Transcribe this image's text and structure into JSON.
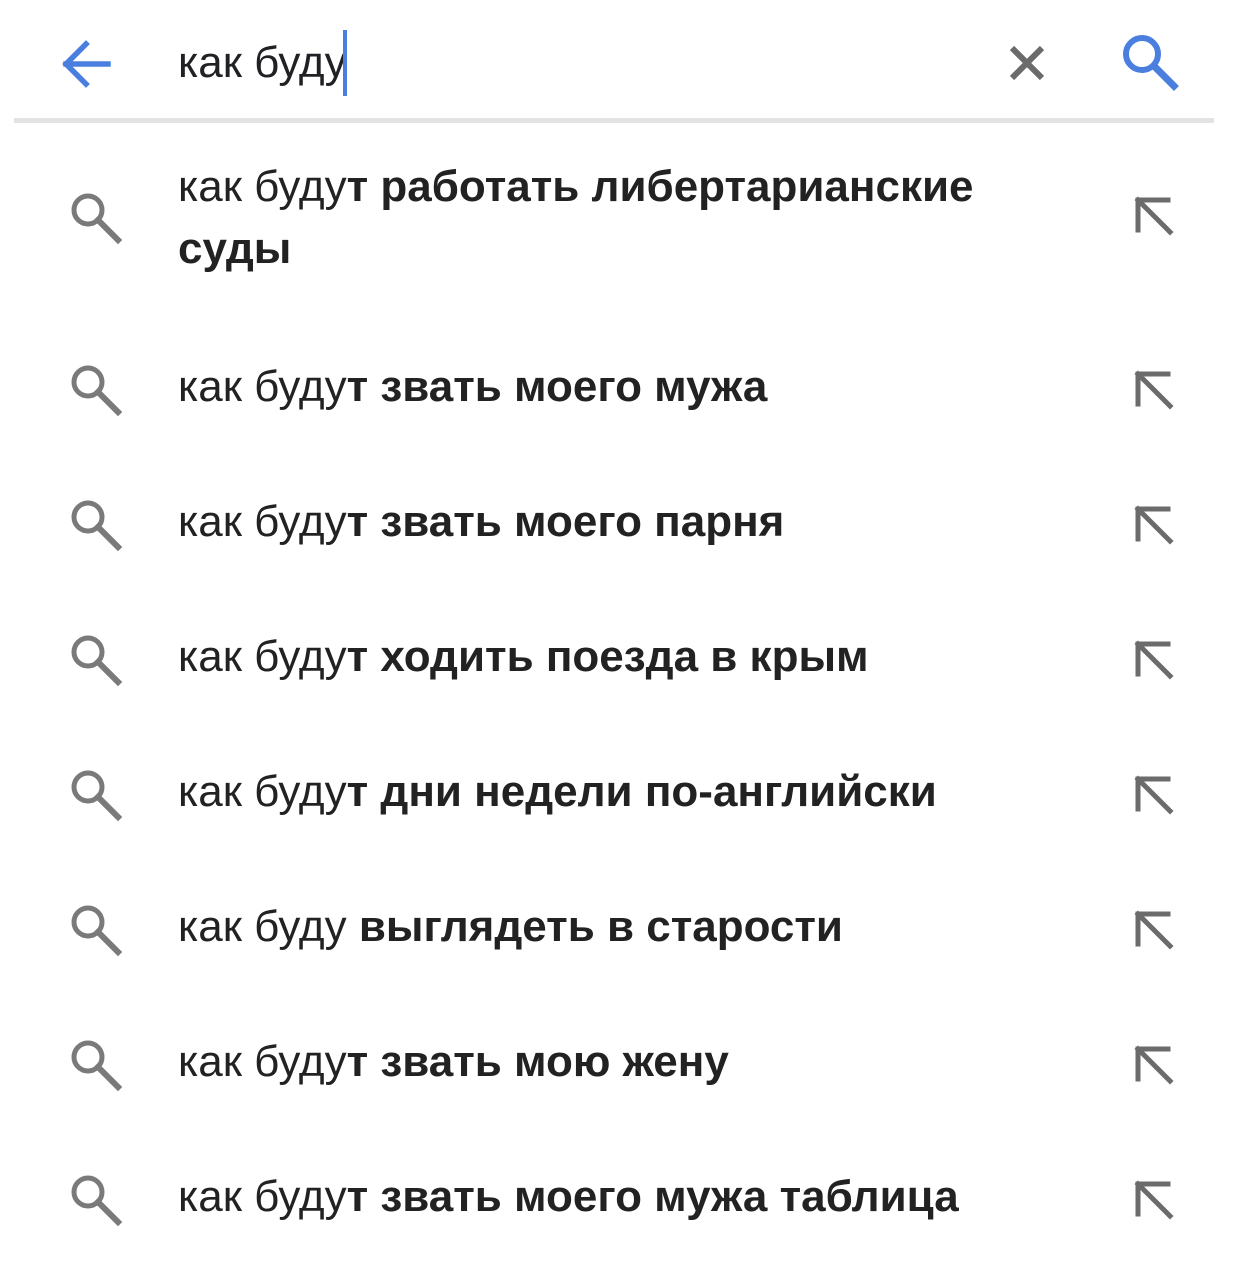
{
  "search": {
    "query": "как буду"
  },
  "colors": {
    "accent": "#4a7fe0",
    "icon_gray": "#7a7a7a",
    "clear_gray": "#6b6b6b",
    "divider": "#e3e3e3"
  },
  "icons": {
    "back": "arrow-left-icon",
    "clear": "close-icon",
    "search": "search-icon",
    "suggestion": "search-icon",
    "fill": "arrow-up-left-icon"
  },
  "suggestions": [
    {
      "prefix": "как буду",
      "suffix": "т работать либертарианские суды"
    },
    {
      "prefix": "как буду",
      "suffix": "т звать моего мужа"
    },
    {
      "prefix": "как буду",
      "suffix": "т звать моего парня"
    },
    {
      "prefix": "как буду",
      "suffix": "т ходить поезда в крым"
    },
    {
      "prefix": "как буду",
      "suffix": "т дни недели по-английски"
    },
    {
      "prefix": "как буду ",
      "suffix": "выглядеть в старости"
    },
    {
      "prefix": "как буду",
      "suffix": "т звать мою жену"
    },
    {
      "prefix": "как буду",
      "suffix": "т звать моего мужа таблица"
    }
  ]
}
